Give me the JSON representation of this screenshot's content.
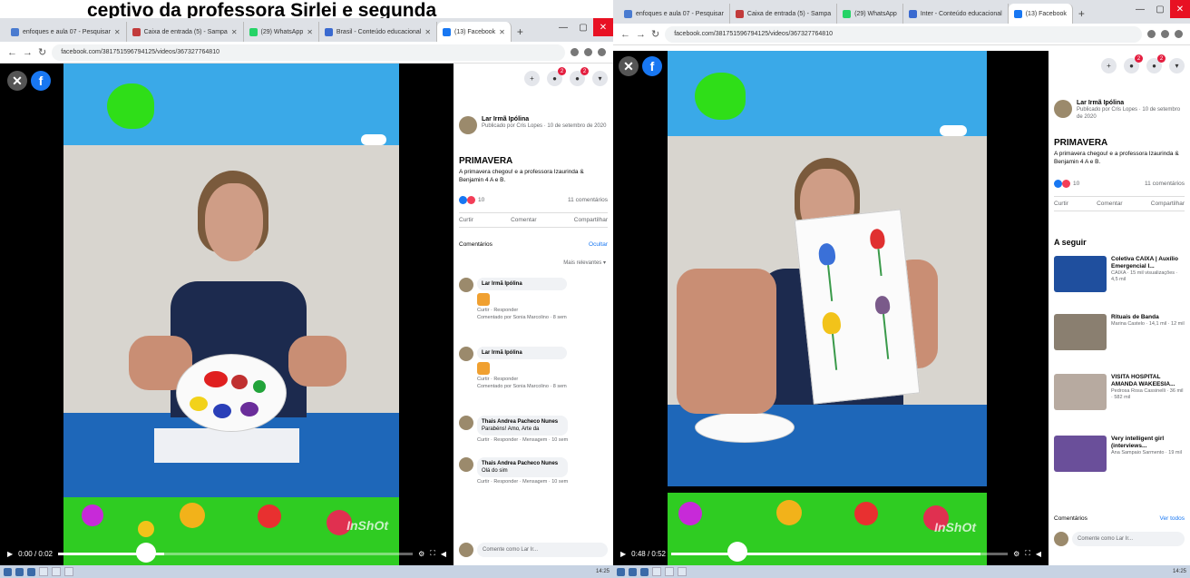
{
  "caption": "ceptivo da professora Sirlei e segunda",
  "left": {
    "tabs": [
      {
        "label": "enfoques e aula 07 - Pesquisar",
        "color": "#4a7bd0"
      },
      {
        "label": "Caixa de entrada (5) - Sampa",
        "color": "#c23b3b"
      },
      {
        "label": "(29) WhatsApp",
        "color": "#25d366"
      },
      {
        "label": "Brasil - Conteúdo educacional",
        "color": "#3a6ad0"
      },
      {
        "label": "(13) Facebook",
        "color": "#1877f2"
      }
    ],
    "url": "facebook.com/381751596794125/videos/367327764810",
    "page": {
      "name": "Lar Irmã Ipólina",
      "meta": "Publicado por Cris Lopes · 10 de setembro de 2020",
      "title": "PRIMAVERA",
      "desc": "A primavera chegou! e a professora Izaurinda & Benjamin 4 A e B.",
      "reactions": "10",
      "comments_count": "11 comentários"
    },
    "actions": [
      "Curtir",
      "Comentar",
      "Compartilhar"
    ],
    "comments_label": "Comentários",
    "comments_hide": "Ocultar",
    "sort": "Mais relevantes",
    "comments": [
      {
        "name": "Lar Irmã Ipólina",
        "meta": "Curtir · Responder",
        "reply": "Comentado por Sonia Marcolino · 8 sem",
        "sticker": true
      },
      {
        "name": "Lar Irmã Ipólina",
        "meta": "Curtir · Responder",
        "reply": "Comentado por Sonia Marcolino · 8 sem",
        "sticker": true
      },
      {
        "name": "Thais Andrea Pacheco Nunes",
        "text": "Parabéns! Amo, Arte da",
        "meta": "Curtir · Responder · Mensagem · 10 sem",
        "sticker": false
      },
      {
        "name": "Thais Andrea Pacheco Nunes",
        "text": "Olá do sim",
        "meta": "Curtir · Responder · Mensagem · 10 sem",
        "sticker": false
      }
    ],
    "input_placeholder": "Comente como Lar Ir...",
    "time": "0:00 / 0:02",
    "watermark": "InShOt",
    "taskbar_clock": "14:25"
  },
  "right": {
    "tabs": [
      {
        "label": "enfoques e aula 07 - Pesquisar",
        "color": "#4a7bd0"
      },
      {
        "label": "Caixa de entrada (5) - Sampa",
        "color": "#c23b3b"
      },
      {
        "label": "(29) WhatsApp",
        "color": "#25d366"
      },
      {
        "label": "Inter - Conteúdo educacional",
        "color": "#3a6ad0"
      },
      {
        "label": "(13) Facebook",
        "color": "#1877f2"
      }
    ],
    "url": "facebook.com/381751596794125/videos/367327764810",
    "page": {
      "name": "Lar Irmã Ipólina",
      "meta": "Publicado por Cris Lopes · 10 de setembro de 2020",
      "title": "PRIMAVERA",
      "desc": "A primavera chegou! e a professora Izaurinda & Benjamin 4 A e B.",
      "reactions": "10",
      "comments_count": "11 comentários"
    },
    "actions": [
      "Curtir",
      "Comentar",
      "Compartilhar"
    ],
    "next_title": "A seguir",
    "next": [
      {
        "title": "Coletiva CAIXA | Auxílio Emergencial I...",
        "sub": "CAIXA · 15 mil visualizações · 4,5 mil",
        "thumb": "#1f4f9e"
      },
      {
        "title": "Rituais de Banda",
        "sub": "Marina Castelo · 14,1 mil · 12 mil",
        "thumb": "#8a7f70"
      },
      {
        "title": "VISITA HOSPITAL AMANDA WAKEESIA...",
        "sub": "Pedrosa Rosa Cassinelli · 36 mil · 582 mil",
        "thumb": "#b7aaa0"
      },
      {
        "title": "Very intelligent girl (interviews...",
        "sub": "Ana Sampaio Sarmento · 19 mil",
        "thumb": "#6a4f9a"
      }
    ],
    "comments_label": "Comentários",
    "comments_more": "Ver todos",
    "input_placeholder": "Comente como Lar Ir...",
    "time": "0:48 / 0:52",
    "watermark": "InShOt",
    "taskbar_clock": "14:25"
  }
}
